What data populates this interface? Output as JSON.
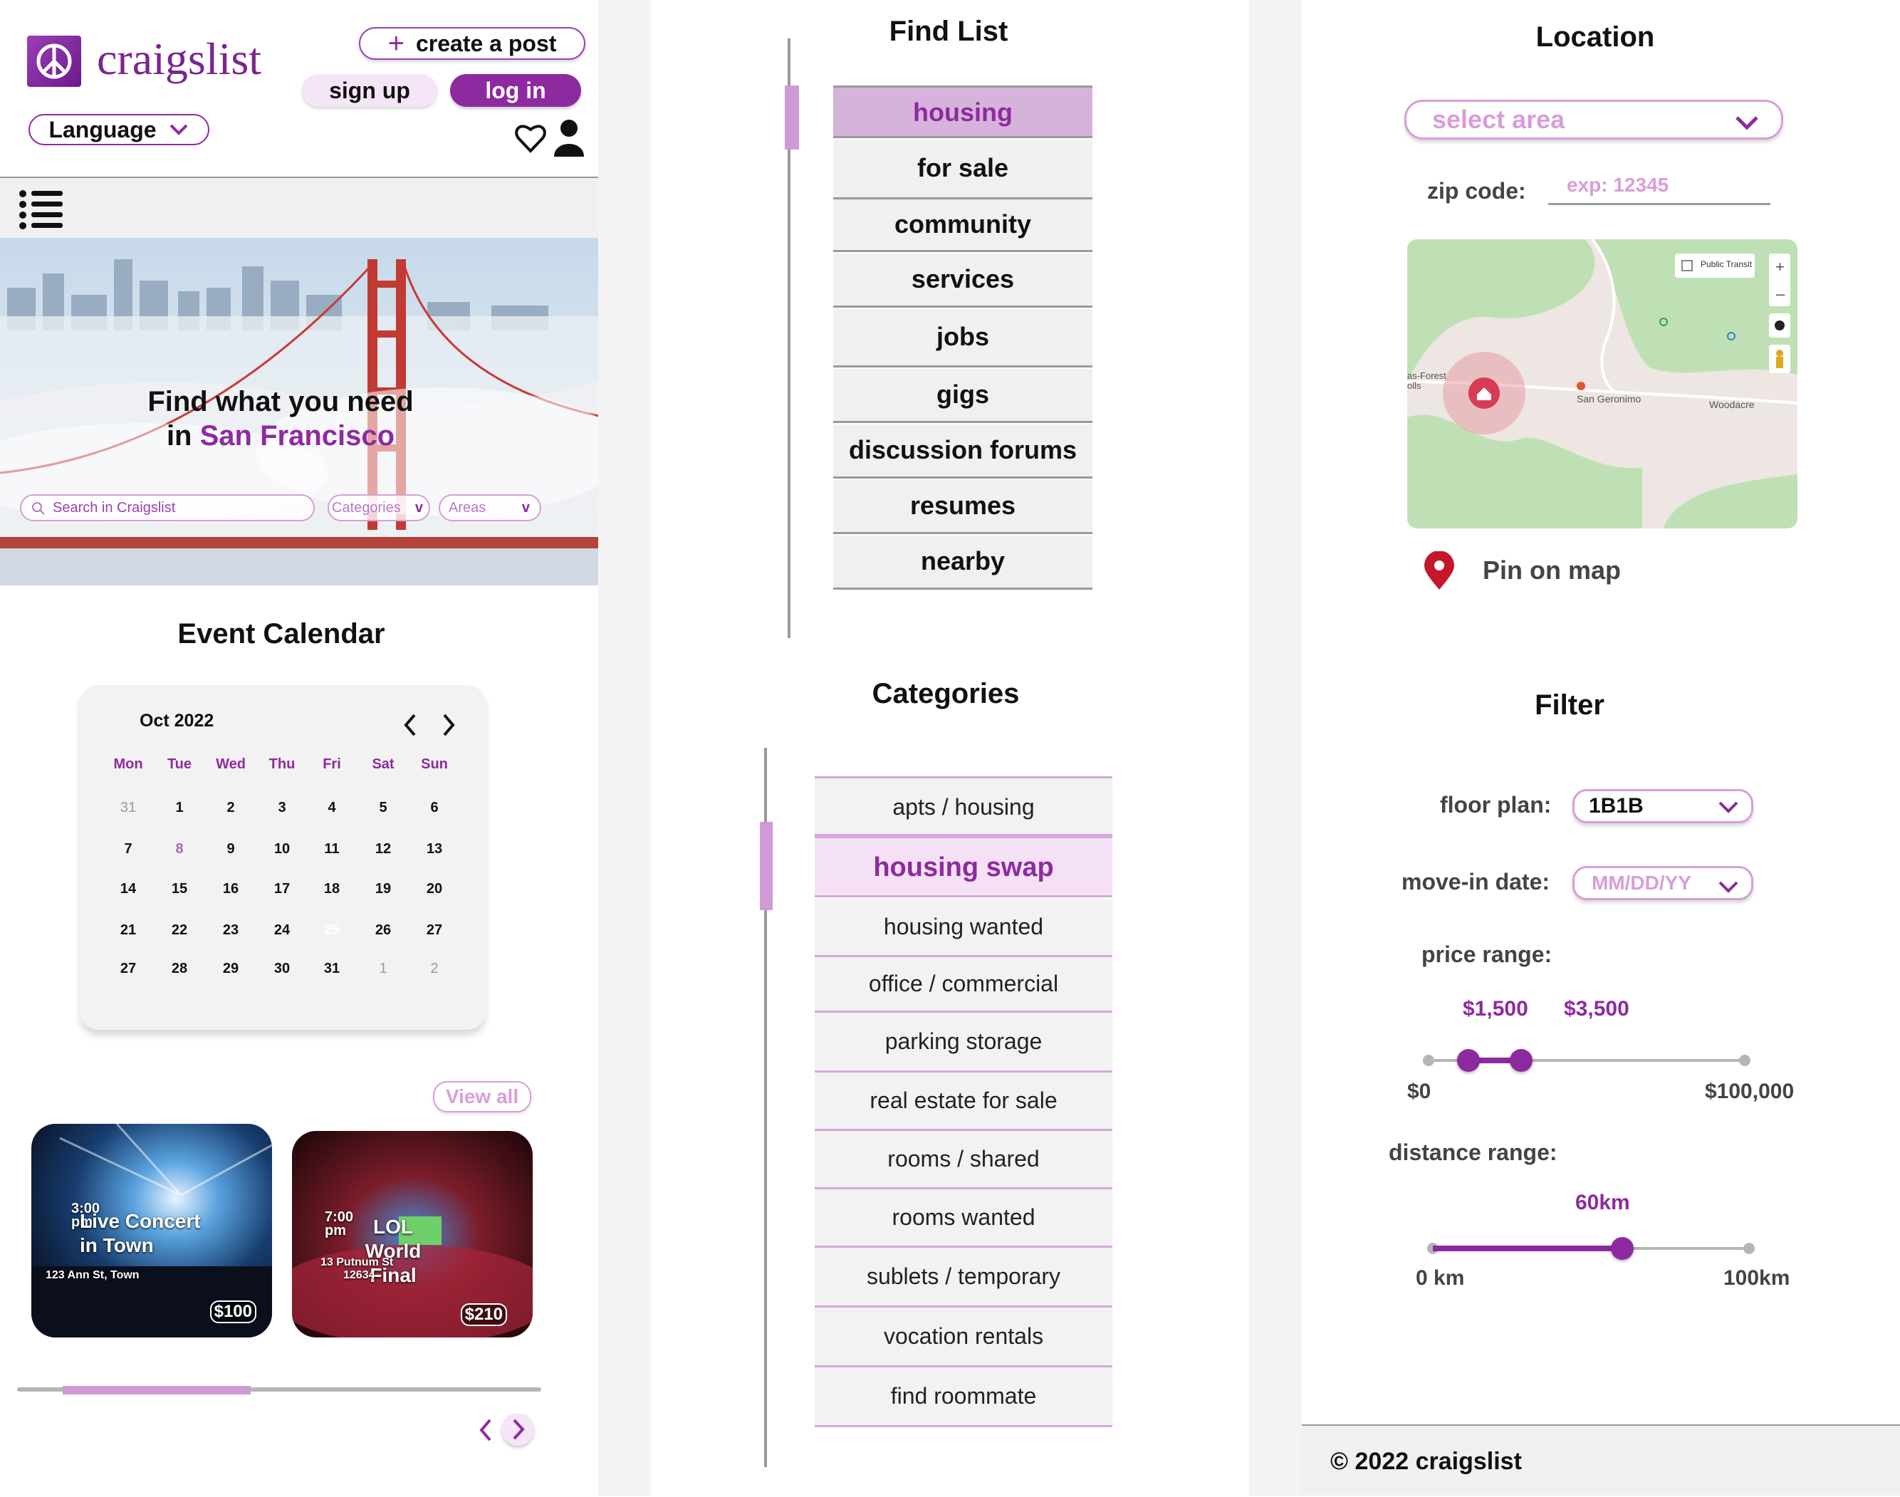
{
  "header": {
    "logo_text": "craigslist",
    "create_post": "create a post",
    "sign_up": "sign up",
    "log_in": "log in",
    "language": "Language"
  },
  "hero": {
    "title_line1": "Find what you need",
    "title_in": "in",
    "title_city": "San Francisco",
    "search_placeholder": "Search in Craigslist",
    "categories_select": "Categories",
    "areas_select": "Areas"
  },
  "calendar": {
    "section_title": "Event Calendar",
    "month": "Oct 2022",
    "weekdays": [
      "Mon",
      "Tue",
      "Wed",
      "Thu",
      "Fri",
      "Sat",
      "Sun"
    ],
    "weeks": [
      [
        "31",
        "1",
        "2",
        "3",
        "4",
        "5",
        "6"
      ],
      [
        "7",
        "8",
        "9",
        "10",
        "11",
        "12",
        "13"
      ],
      [
        "14",
        "15",
        "16",
        "17",
        "18",
        "19",
        "20"
      ],
      [
        "21",
        "22",
        "23",
        "24",
        "25",
        "26",
        "27"
      ],
      [
        "27",
        "28",
        "29",
        "30",
        "31",
        "1",
        "2"
      ]
    ],
    "today": "8",
    "selected": "25"
  },
  "events": {
    "view_all": "View all",
    "items": [
      {
        "time": "3:00",
        "ampm": "pm",
        "name": "Live Concert in Town",
        "address": "123 Ann St, Town",
        "price": "$100"
      },
      {
        "time": "7:00",
        "ampm": "pm",
        "name": "LOL World Final",
        "address": "13 Putnum St",
        "address2": "12634",
        "price": "$210"
      }
    ]
  },
  "find_list": {
    "title": "Find List",
    "items": [
      "housing",
      "for sale",
      "community",
      "services",
      "jobs",
      "gigs",
      "discussion forums",
      "resumes",
      "nearby"
    ],
    "active": "housing"
  },
  "categories": {
    "title": "Categories",
    "items": [
      "apts / housing",
      "housing swap",
      "housing wanted",
      "office / commercial",
      "parking storage",
      "real estate for sale",
      "rooms / shared",
      "rooms wanted",
      "sublets / temporary",
      "vocation rentals",
      "find roommate"
    ],
    "active": "housing swap"
  },
  "location": {
    "title": "Location",
    "select_area": "select area",
    "zip_label": "zip code:",
    "zip_placeholder": "exp: 12345",
    "map_labels": {
      "transit": "Public Transit",
      "place1": "San Geronimo",
      "place2": "Woodacre",
      "place3": "as-Forest",
      "place4": "olls"
    },
    "pin_label": "Pin on map"
  },
  "filter": {
    "title": "Filter",
    "floor_plan_label": "floor plan:",
    "floor_plan_value": "1B1B",
    "move_in_label": "move-in date:",
    "move_in_placeholder": "MM/DD/YY",
    "price_label": "price range:",
    "price_low": "$1,500",
    "price_high": "$3,500",
    "price_min": "$0",
    "price_max": "$100,000",
    "price_low_value": 1500,
    "price_high_value": 3500,
    "distance_label": "distance range:",
    "distance_value_label": "60km",
    "distance_min": "0 km",
    "distance_max": "100km",
    "distance_value": 60
  },
  "footer": {
    "text": "2022 craigslist",
    "copyright_symbol": "©"
  },
  "colors": {
    "accent": "#8e2a9f",
    "accent_light": "#d89ed8",
    "accent_pale": "#f4e1f6"
  }
}
